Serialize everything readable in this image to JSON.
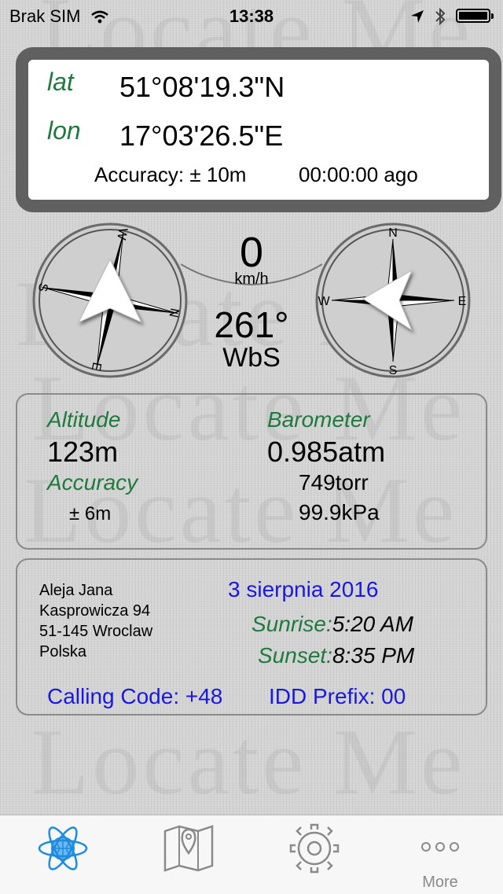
{
  "status_bar": {
    "carrier": "Brak SIM",
    "time": "13:38"
  },
  "watermark_text": "Locate Me",
  "coordinates": {
    "lat_label": "lat",
    "lat_value": "51°08'19.3\"N",
    "lon_label": "lon",
    "lon_value": "17°03'26.5\"E",
    "accuracy": "Accuracy: ± 10m",
    "age": "00:00:00 ago"
  },
  "compass": {
    "speed_value": "0",
    "speed_unit": "km/h",
    "heading_deg": "261°",
    "heading_dir": "WbS",
    "left_rose_labels": {
      "n": "N",
      "s": "S",
      "e": "E",
      "w": "W"
    },
    "right_rose_labels": {
      "n": "N",
      "s": "S",
      "e": "E",
      "w": "W"
    }
  },
  "altitude_panel": {
    "altitude_label": "Altitude",
    "altitude_value": "123m",
    "accuracy_label": "Accuracy",
    "accuracy_value": "± 6m",
    "barometer_label": "Barometer",
    "barometer_atm": "0.985atm",
    "barometer_torr": "749torr",
    "barometer_kpa": "99.9kPa"
  },
  "address_panel": {
    "address_lines": [
      "Aleja Jana",
      "Kasprowicza 94",
      "51-145 Wroclaw",
      "Polska"
    ],
    "date": "3 sierpnia 2016",
    "sunrise_label": "Sunrise:",
    "sunrise_value": "5:20 AM",
    "sunset_label": "Sunset:",
    "sunset_value": "8:35 PM",
    "calling_code": "Calling Code: +48",
    "idd_prefix": "IDD Prefix: 00"
  },
  "tab_bar": {
    "items": [
      {
        "icon": "atom-icon",
        "label": ""
      },
      {
        "icon": "map-pin-icon",
        "label": ""
      },
      {
        "icon": "gear-icon",
        "label": ""
      },
      {
        "icon": "more-icon",
        "label": "More"
      }
    ]
  },
  "colors": {
    "accent_green": "#1f7a3e",
    "accent_blue": "#1a18e0",
    "tab_active": "#1d8ce0"
  }
}
